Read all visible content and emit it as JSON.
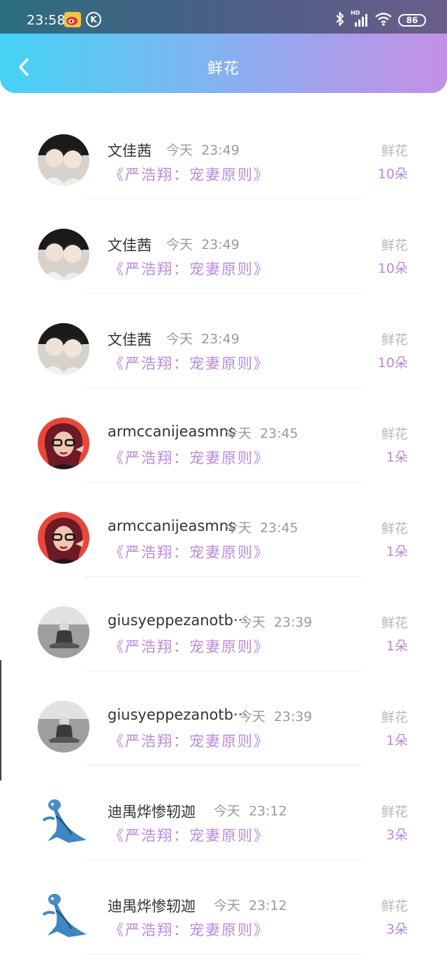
{
  "status_bar": {
    "time": "23:58",
    "k_badge": "K",
    "network": "HD",
    "battery": "86"
  },
  "header": {
    "title": "鲜花"
  },
  "colors": {
    "accent_purple": "#b88ad8",
    "gradient_start": "#44d3f4",
    "gradient_end": "#c391e6"
  },
  "rows": [
    {
      "name": "文佳茜",
      "day": "今天",
      "time": "23:49",
      "book": "《严浩翔：宠妻原则》",
      "label": "鲜花",
      "count": "10朵",
      "avatar": "couple-avatar"
    },
    {
      "name": "文佳茜",
      "day": "今天",
      "time": "23:49",
      "book": "《严浩翔：宠妻原则》",
      "label": "鲜花",
      "count": "10朵",
      "avatar": "couple-avatar"
    },
    {
      "name": "文佳茜",
      "day": "今天",
      "time": "23:49",
      "book": "《严浩翔：宠妻原则》",
      "label": "鲜花",
      "count": "10朵",
      "avatar": "couple-avatar"
    },
    {
      "name": "armccanijeasmns",
      "day": "今天",
      "time": "23:45",
      "book": "《严浩翔：宠妻原则》",
      "label": "鲜花",
      "count": "1朵",
      "avatar": "red-hair-avatar"
    },
    {
      "name": "armccanijeasmns",
      "day": "今天",
      "time": "23:45",
      "book": "《严浩翔：宠妻原则》",
      "label": "鲜花",
      "count": "1朵",
      "avatar": "red-hair-avatar"
    },
    {
      "name": "giusyeppezanotb···",
      "day": "今天",
      "time": "23:39",
      "book": "《严浩翔：宠妻原则》",
      "label": "鲜花",
      "count": "1朵",
      "avatar": "grayscale-child-avatar"
    },
    {
      "name": "giusyeppezanotb···",
      "day": "今天",
      "time": "23:39",
      "book": "《严浩翔：宠妻原则》",
      "label": "鲜花",
      "count": "1朵",
      "avatar": "grayscale-child-avatar"
    },
    {
      "name": "迪禺烨惨轫迦",
      "day": "今天",
      "time": "23:12",
      "book": "《严浩翔：宠妻原则》",
      "label": "鲜花",
      "count": "3朵",
      "avatar": "blue-creature-avatar"
    },
    {
      "name": "迪禺烨惨轫迦",
      "day": "今天",
      "time": "23:12",
      "book": "《严浩翔：宠妻原则》",
      "label": "鲜花",
      "count": "3朵",
      "avatar": "blue-creature-avatar"
    }
  ]
}
